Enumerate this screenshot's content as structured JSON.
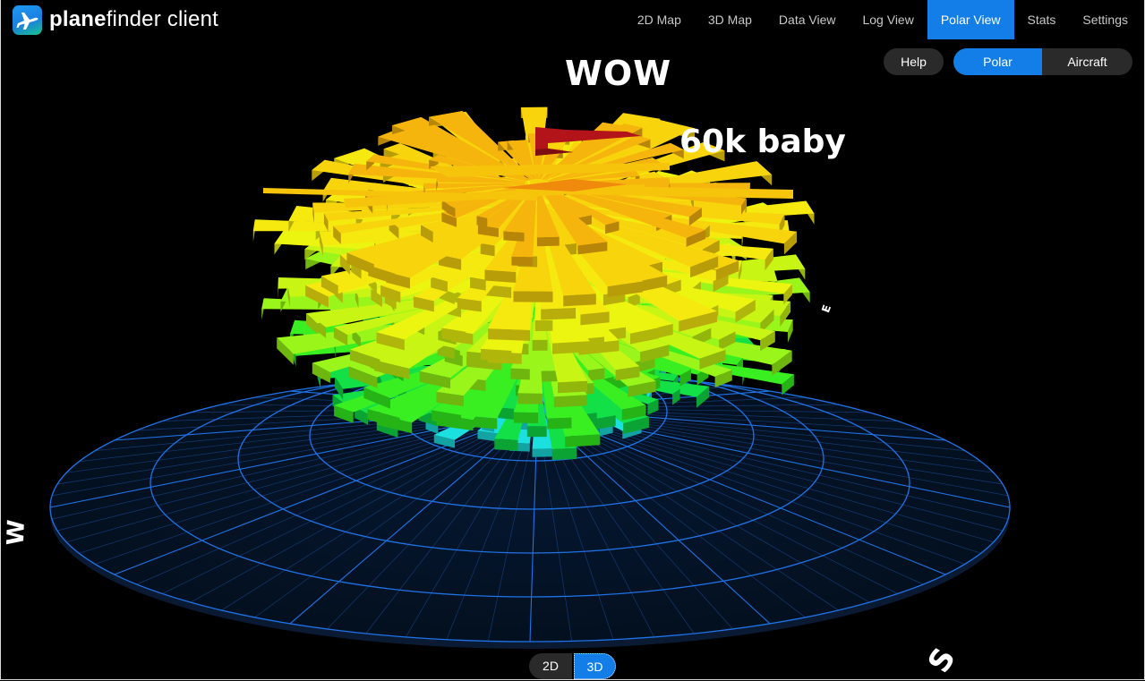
{
  "header": {
    "brand_bold": "plane",
    "brand_rest": "finder client",
    "nav": [
      {
        "label": "2D Map",
        "active": false
      },
      {
        "label": "3D Map",
        "active": false
      },
      {
        "label": "Data View",
        "active": false
      },
      {
        "label": "Log View",
        "active": false
      },
      {
        "label": "Polar View",
        "active": true
      },
      {
        "label": "Stats",
        "active": false
      },
      {
        "label": "Settings",
        "active": false
      }
    ]
  },
  "controls": {
    "help_label": "Help",
    "polar_label": "Polar",
    "aircraft_label": "Aircraft",
    "polar_active": true
  },
  "annotations": {
    "wow": "WOW",
    "sixty_k": "60k baby"
  },
  "compass": {
    "west": "W",
    "east": "E",
    "south": "S"
  },
  "view_toggle": {
    "label_2d": "2D",
    "label_3d": "3D",
    "active": "3D"
  },
  "colors": {
    "accent": "#137ee8",
    "ring": "#1f73e8",
    "background": "#000000"
  },
  "icons": {
    "logo": "plane-logo-icon"
  }
}
